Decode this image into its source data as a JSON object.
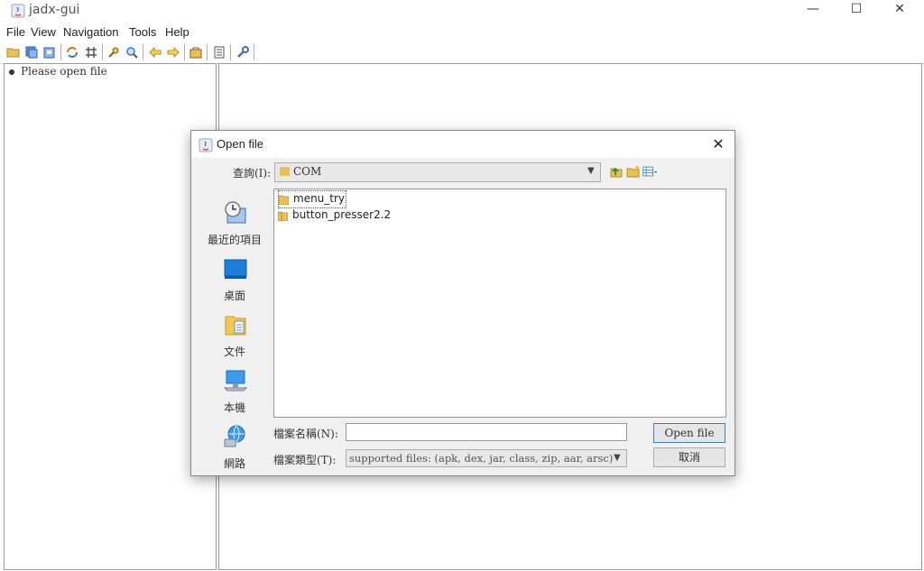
{
  "window": {
    "title": "jadx-gui",
    "minimize": "—",
    "maximize": "☐",
    "close": "✕"
  },
  "menu": [
    "File",
    "View",
    "Navigation",
    "Tools",
    "Help"
  ],
  "tree": {
    "placeholder": "Please open file"
  },
  "dialog": {
    "title": "Open file",
    "close": "✕",
    "look_in_label": "查詢(I):",
    "look_in_value": "COM",
    "places": [
      "最近的項目",
      "桌面",
      "文件",
      "本機",
      "網路"
    ],
    "files": [
      {
        "name": "menu_try",
        "icon": "folder-icon"
      },
      {
        "name": "button_presser2.2",
        "icon": "folder-zip-icon"
      }
    ],
    "filename_label": "檔案名稱(N):",
    "filename_value": "",
    "filetype_label": "檔案類型(T):",
    "filetype_value": "supported files: (apk, dex, jar, class, zip, aar, arsc)",
    "open_button": "Open file",
    "cancel_button": "取消"
  },
  "colors": {
    "folder": "#e8c15a",
    "accent": "#3c7fb1",
    "icon_blue": "#1e7fd8"
  }
}
